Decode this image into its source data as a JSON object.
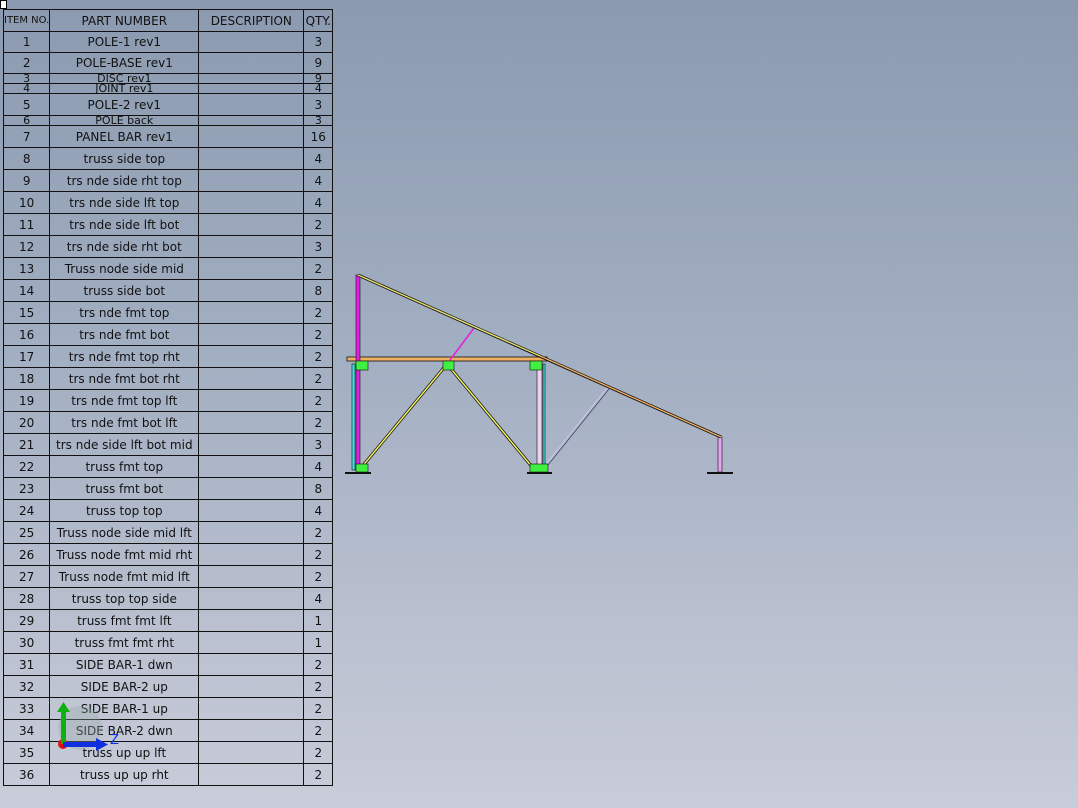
{
  "bom": {
    "headers": {
      "item": "ITEM NO.",
      "part": "PART NUMBER",
      "desc": "DESCRIPTION",
      "qty": "QTY."
    },
    "rows": [
      {
        "item": "1",
        "part": "POLE-1 rev1",
        "desc": "",
        "qty": "3"
      },
      {
        "item": "2",
        "part": "POLE-BASE rev1",
        "desc": "",
        "qty": "9"
      },
      {
        "item": "3",
        "part": "DISC rev1",
        "desc": "",
        "qty": "9"
      },
      {
        "item": "4",
        "part": "JOINT rev1",
        "desc": "",
        "qty": "4"
      },
      {
        "item": "5",
        "part": "POLE-2 rev1",
        "desc": "",
        "qty": "3"
      },
      {
        "item": "6",
        "part": "POLE back",
        "desc": "",
        "qty": "3"
      },
      {
        "item": "7",
        "part": "PANEL BAR rev1",
        "desc": "",
        "qty": "16"
      },
      {
        "item": "8",
        "part": "truss side top",
        "desc": "",
        "qty": "4"
      },
      {
        "item": "9",
        "part": "trs nde side rht top",
        "desc": "",
        "qty": "4"
      },
      {
        "item": "10",
        "part": "trs nde side lft top",
        "desc": "",
        "qty": "4"
      },
      {
        "item": "11",
        "part": "trs nde side lft bot",
        "desc": "",
        "qty": "2"
      },
      {
        "item": "12",
        "part": "trs nde side rht bot",
        "desc": "",
        "qty": "3"
      },
      {
        "item": "13",
        "part": "Truss node side mid",
        "desc": "",
        "qty": "2"
      },
      {
        "item": "14",
        "part": "truss side bot",
        "desc": "",
        "qty": "8"
      },
      {
        "item": "15",
        "part": "trs nde fmt top",
        "desc": "",
        "qty": "2"
      },
      {
        "item": "16",
        "part": "trs nde fmt bot",
        "desc": "",
        "qty": "2"
      },
      {
        "item": "17",
        "part": "trs nde fmt top rht",
        "desc": "",
        "qty": "2"
      },
      {
        "item": "18",
        "part": "trs nde fmt bot rht",
        "desc": "",
        "qty": "2"
      },
      {
        "item": "19",
        "part": "trs nde fmt top lft",
        "desc": "",
        "qty": "2"
      },
      {
        "item": "20",
        "part": "trs nde fmt bot lft",
        "desc": "",
        "qty": "2"
      },
      {
        "item": "21",
        "part": "trs nde side lft bot mid",
        "desc": "",
        "qty": "3"
      },
      {
        "item": "22",
        "part": "truss fmt top",
        "desc": "",
        "qty": "4"
      },
      {
        "item": "23",
        "part": "truss fmt bot",
        "desc": "",
        "qty": "8"
      },
      {
        "item": "24",
        "part": "truss top top",
        "desc": "",
        "qty": "4"
      },
      {
        "item": "25",
        "part": "Truss node side mid lft",
        "desc": "",
        "qty": "2"
      },
      {
        "item": "26",
        "part": "Truss node fmt mid rht",
        "desc": "",
        "qty": "2"
      },
      {
        "item": "27",
        "part": "Truss node fmt mid lft",
        "desc": "",
        "qty": "2"
      },
      {
        "item": "28",
        "part": "truss top top side",
        "desc": "",
        "qty": "4"
      },
      {
        "item": "29",
        "part": "truss fmt fmt lft",
        "desc": "",
        "qty": "1"
      },
      {
        "item": "30",
        "part": "truss fmt fmt rht",
        "desc": "",
        "qty": "1"
      },
      {
        "item": "31",
        "part": "SIDE BAR-1 dwn",
        "desc": "",
        "qty": "2"
      },
      {
        "item": "32",
        "part": "SIDE BAR-2 up",
        "desc": "",
        "qty": "2"
      },
      {
        "item": "33",
        "part": "SIDE BAR-1 up",
        "desc": "",
        "qty": "2"
      },
      {
        "item": "34",
        "part": "SIDE BAR-2 dwn",
        "desc": "",
        "qty": "2"
      },
      {
        "item": "35",
        "part": "truss up up lft",
        "desc": "",
        "qty": "2"
      },
      {
        "item": "36",
        "part": "truss up up rht",
        "desc": "",
        "qty": "2"
      }
    ]
  },
  "triad": {
    "y_label": "Y",
    "z_label": "Z",
    "colors": {
      "x": "#e01010",
      "y": "#10b010",
      "z": "#1030e0"
    }
  },
  "colors": {
    "pole": "#e020e0",
    "pole_light": "#e8a0f0",
    "truss": "#f0f060",
    "rafter": "#f0b060",
    "node": "#40f040",
    "brace": "#c0c0e8"
  }
}
